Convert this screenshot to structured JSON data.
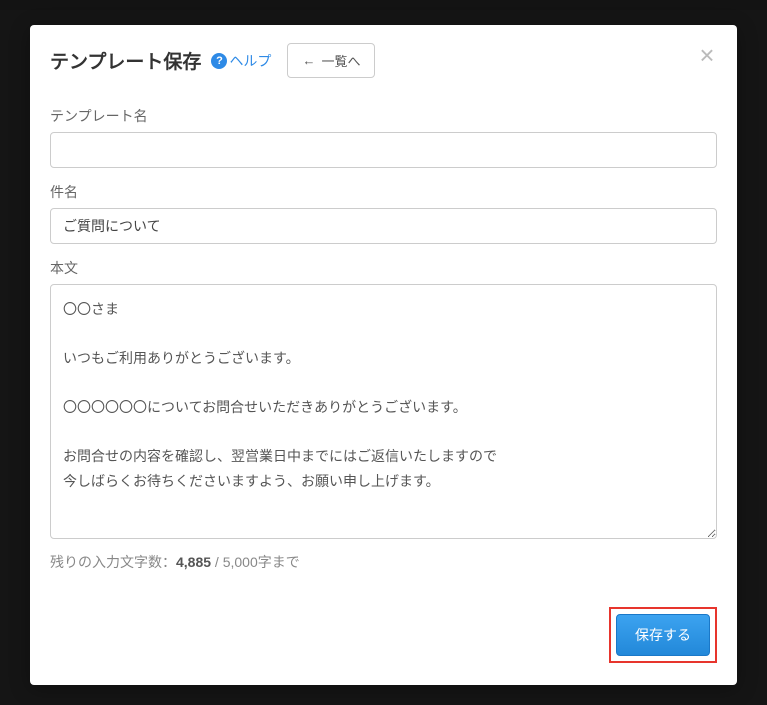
{
  "modal": {
    "title": "テンプレート保存",
    "help_label": "ヘルプ",
    "back_label": "一覧へ",
    "close_label": "×"
  },
  "form": {
    "template_name": {
      "label": "テンプレート名",
      "value": ""
    },
    "subject": {
      "label": "件名",
      "value": "ご質問について"
    },
    "body": {
      "label": "本文",
      "value": "〇〇さま\n\nいつもご利用ありがとうございます。\n\n〇〇〇〇〇〇についてお問合せいただきありがとうございます。\n\nお問合せの内容を確認し、翌営業日中までにはご返信いたしますので\n今しばらくお待ちくださいますよう、お願い申し上げます。"
    },
    "char_count": {
      "prefix": "残りの入力文字数：",
      "current": "4,885",
      "separator": " / ",
      "limit": "5,000字まで"
    }
  },
  "footer": {
    "save_label": "保存する"
  }
}
